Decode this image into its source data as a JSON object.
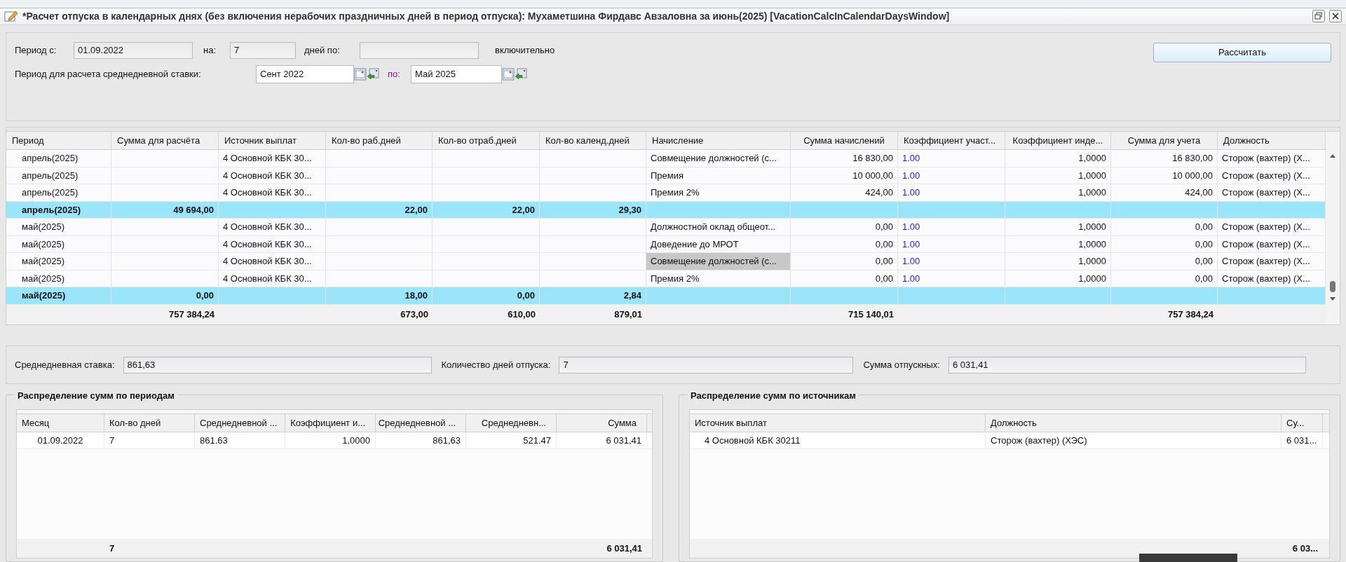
{
  "window": {
    "title": "*Расчет отпуска в календарных днях (без включения нерабочих праздничных дней в период отпуска): Мухаметшина Фирдавс Авзаловна за июнь(2025) [VacationCalcInCalendarDaysWindow]"
  },
  "params": {
    "from_label": "Период с:",
    "from_value": "01.09.2022",
    "days_label": "на:",
    "days_value": "7",
    "to_label": "дней по:",
    "inclusive_label": "включительно",
    "avg_label": "Период для расчета среднедневной ставки:",
    "avg_from": "Сент 2022",
    "avg_to_label": "по:",
    "avg_to": "Май 2025",
    "calc_button": "Рассчитать"
  },
  "table": {
    "columns": [
      "Период",
      "Сумма для расчёта",
      "Источник выплат",
      "Кол-во раб.дней",
      "Кол-во отраб.дней",
      "Кол-во календ.дней",
      "Начисление",
      "Сумма начислений",
      "Коэффициент участ...",
      "Коэффициент инде...",
      "Сумма для учета",
      "Должность"
    ],
    "rows": [
      {
        "kind": "detail",
        "selected": false,
        "period": "апрель(2025)",
        "source": "4 Основной КБК 30...",
        "accrual": "Совмещение должностей (с...",
        "accrual_sum": "16 830,00",
        "part_coef": "1.00",
        "index_coef": "1,0000",
        "account_sum": "16 830,00",
        "position": "Сторож (вахтер) (Х..."
      },
      {
        "kind": "detail",
        "selected": false,
        "period": "апрель(2025)",
        "source": "4 Основной КБК 30...",
        "accrual": "Премия",
        "accrual_sum": "10 000,00",
        "part_coef": "1.00",
        "index_coef": "1,0000",
        "account_sum": "10 000,00",
        "position": "Сторож (вахтер) (Х..."
      },
      {
        "kind": "detail",
        "selected": false,
        "period": "апрель(2025)",
        "source": "4 Основной КБК 30...",
        "accrual": "Премия 2%",
        "accrual_sum": "424,00",
        "part_coef": "1.00",
        "index_coef": "1,0000",
        "account_sum": "424,00",
        "position": "Сторож (вахтер) (Х..."
      },
      {
        "kind": "subtotal",
        "selected": false,
        "period": "апрель(2025)",
        "calc_sum": "49 694,00",
        "work_days": "22,00",
        "worked_days": "22,00",
        "cal_days": "29,30"
      },
      {
        "kind": "detail",
        "selected": false,
        "period": "май(2025)",
        "source": "4 Основной КБК 30...",
        "accrual": "Должностной оклад общеот...",
        "accrual_sum": "0,00",
        "part_coef": "1.00",
        "index_coef": "1,0000",
        "account_sum": "0,00",
        "position": "Сторож (вахтер) (Х..."
      },
      {
        "kind": "detail",
        "selected": false,
        "period": "май(2025)",
        "source": "4 Основной КБК 30...",
        "accrual": "Доведение до МРОТ",
        "accrual_sum": "0,00",
        "part_coef": "1.00",
        "index_coef": "1,0000",
        "account_sum": "0,00",
        "position": "Сторож (вахтер) (Х..."
      },
      {
        "kind": "detail",
        "selected": true,
        "period": "май(2025)",
        "source": "4 Основной КБК 30...",
        "accrual": "Совмещение должностей (с...",
        "accrual_sum": "0,00",
        "part_coef": "1.00",
        "index_coef": "1,0000",
        "account_sum": "0,00",
        "position": "Сторож (вахтер) (Х..."
      },
      {
        "kind": "detail",
        "selected": false,
        "period": "май(2025)",
        "source": "4 Основной КБК 30...",
        "accrual": "Премия 2%",
        "accrual_sum": "0,00",
        "part_coef": "1.00",
        "index_coef": "1,0000",
        "account_sum": "0,00",
        "position": "Сторож (вахтер) (Х..."
      },
      {
        "kind": "subtotal",
        "selected": false,
        "period": "май(2025)",
        "calc_sum": "0,00",
        "work_days": "18,00",
        "worked_days": "0,00",
        "cal_days": "2,84"
      }
    ],
    "totals": {
      "calc_sum": "757 384,24",
      "work_days": "673,00",
      "worked_days": "610,00",
      "cal_days": "879,01",
      "accrual_sum": "715 140,01",
      "account_sum": "757 384,24"
    }
  },
  "summary": [
    {
      "label": "Среднедневная ставка:",
      "value": "861,63"
    },
    {
      "label": "Количество дней отпуска:",
      "value": "7"
    },
    {
      "label": "Сумма отпускных:",
      "value": "6 031,41"
    }
  ],
  "periods": {
    "title": "Распределение сумм по периодам",
    "columns": [
      "Месяц",
      "Кол-во дней",
      "Среднедневной ...",
      "Коэффициент и...",
      "Среднедневной ...",
      "Среднедневн...",
      "Сумма"
    ],
    "rows": [
      {
        "month": "01.09.2022",
        "days": "7",
        "avg_1": "861.63",
        "coef": "1,0000",
        "avg_2": "861,63",
        "avg_3": "521.47",
        "sum": "6 031,41"
      }
    ],
    "totals": {
      "days": "7",
      "sum": "6 031,41"
    }
  },
  "sources": {
    "title": "Распределение сумм по источникам",
    "columns": [
      "Источник выплат",
      "Должность",
      "Су..."
    ],
    "rows": [
      {
        "source": "4 Основной КБК 30211",
        "position": "Сторож (вахтер) (ХЭС)",
        "sum": "6 031..."
      }
    ],
    "totals": {
      "sum": "6 03..."
    }
  }
}
